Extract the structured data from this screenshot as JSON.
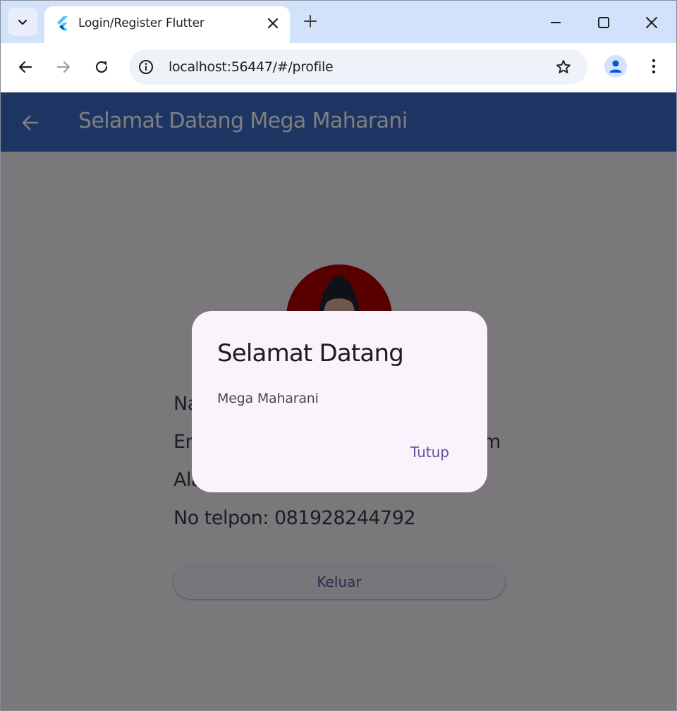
{
  "browser": {
    "tab_title": "Login/Register Flutter",
    "url": "localhost:56447/#/profile"
  },
  "app": {
    "appbar_title": "Selamat Datang Mega Maharani",
    "profile": {
      "name_line": "Na",
      "email_line": "En",
      "email_tail": "m",
      "address_line": "Ala",
      "phone_line": "No telpon: 081928244792"
    },
    "logout_label": "Keluar"
  },
  "dialog": {
    "title": "Selamat Datang",
    "content": "Mega Maharani",
    "close_label": "Tutup"
  },
  "colors": {
    "appbar": "#3a6bc7",
    "accent": "#6750a4",
    "avatar_bg": "#b00000"
  }
}
